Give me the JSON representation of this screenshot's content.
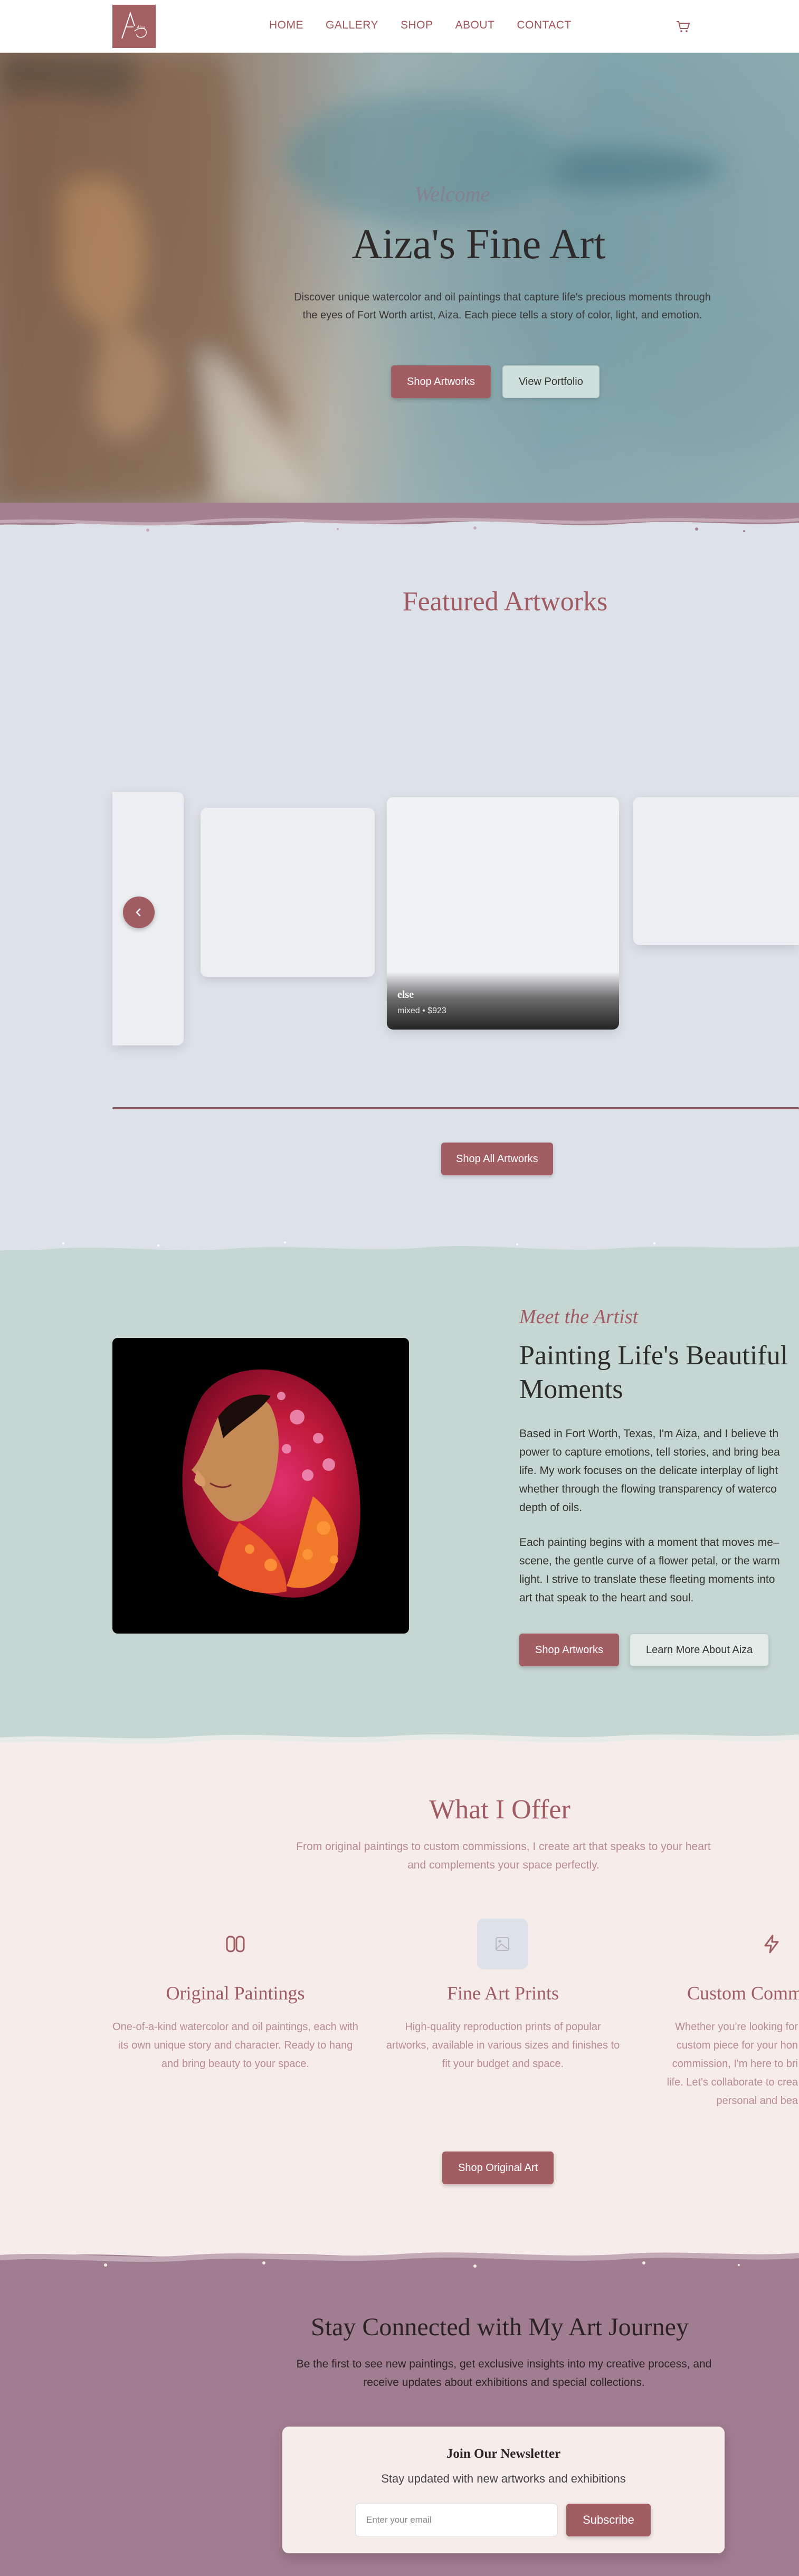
{
  "nav": {
    "logo_text": "Aiza",
    "links": [
      "HOME",
      "GALLERY",
      "SHOP",
      "ABOUT",
      "CONTACT"
    ],
    "cart_icon": "cart-icon"
  },
  "hero": {
    "welcome": "Welcome",
    "title": "Aiza's Fine Art",
    "description": "Discover unique watercolor and oil paintings that capture life's precious moments through the eyes of Fort Worth artist, Aiza. Each piece tells a story of color, light, and emotion.",
    "primary_button": "Shop Artworks",
    "secondary_button": "View Portfolio"
  },
  "featured": {
    "title": "Featured Artworks",
    "active_card": {
      "title": "else",
      "subtitle": "mixed • $923"
    },
    "prev_icon": "chevron-left-icon",
    "shop_all_button": "Shop All Artworks"
  },
  "artist": {
    "eyebrow": "Meet the Artist",
    "title_line1": "Painting Life's Beautiful",
    "title_line2": "Moments",
    "paragraph1_lines": [
      "Based in Fort Worth, Texas, I'm Aiza, and I believe th",
      "power to capture emotions, tell stories, and bring bea",
      "life. My work focuses on the delicate interplay of light",
      "whether through the flowing transparency of waterco",
      "depth of oils."
    ],
    "paragraph2_lines": [
      "Each painting begins with a moment that moves me–",
      "scene, the gentle curve of a flower petal, or the warm",
      "light. I strive to translate these fleeting moments into",
      "art that speak to the heart and soul."
    ],
    "primary_button": "Shop Artworks",
    "secondary_button": "Learn More About Aiza"
  },
  "offer": {
    "title": "What I Offer",
    "subtitle": "From original paintings to custom commissions, I create art that speaks to your heart and complements your space perfectly.",
    "items": [
      {
        "icon": "palette-icon",
        "name": "Original Paintings",
        "description": "One-of-a-kind watercolor and oil paintings, each with its own unique story and character. Ready to hang and bring beauty to your space."
      },
      {
        "icon": "image-icon",
        "name": "Fine Art Prints",
        "description": "High-quality reproduction prints of popular artworks, available in various sizes and finishes to fit your budget and space."
      },
      {
        "icon": "lightning-icon",
        "name": "Custom Comm",
        "description_lines": [
          "Whether you're looking for",
          "custom piece for your hon",
          "commission, I'm here to bri",
          "life. Let's collaborate to crea",
          "personal and bea"
        ]
      }
    ],
    "button": "Shop Original Art"
  },
  "newsletter": {
    "title": "Stay Connected with My Art Journey",
    "description": "Be the first to see new paintings, get exclusive insights into my creative process, and receive updates about exhibitions and special collections.",
    "card_title": "Join Our Newsletter",
    "card_subtitle": "Stay updated with new artworks and exhibitions",
    "email_placeholder": "Enter your email",
    "submit": "Subscribe"
  },
  "colors": {
    "brand": "#a15d62",
    "featured_bg": "#dde2ea",
    "artist_bg": "#c6d6d2",
    "offer_bg": "#f6ecea",
    "newsletter_bg": "#a17d90"
  }
}
